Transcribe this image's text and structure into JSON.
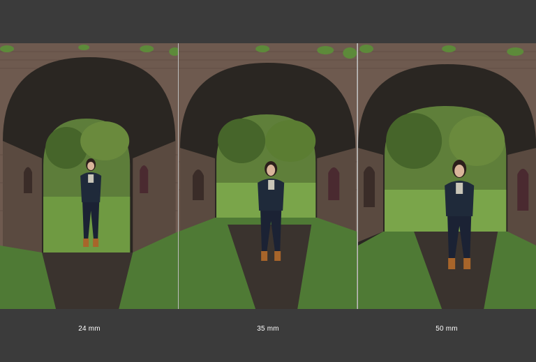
{
  "panels": [
    {
      "caption": "24 mm"
    },
    {
      "caption": "35 mm"
    },
    {
      "caption": "50 mm"
    }
  ],
  "colors": {
    "background": "#3b3b3b",
    "brick": "#6e5a4f",
    "tunnel": "#2a2622",
    "grass": "#4f7a35",
    "path": "#3a332e",
    "foliage": "#4c6a2c",
    "jacket": "#1f2a3a",
    "boots": "#a8652a"
  }
}
